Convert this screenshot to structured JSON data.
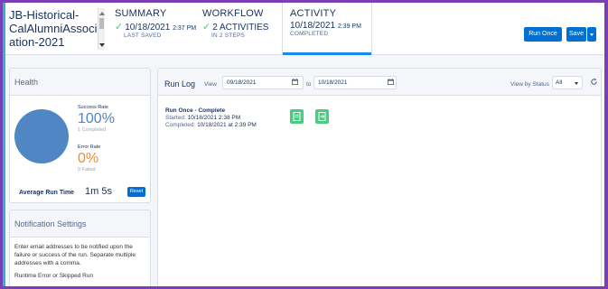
{
  "header": {
    "name": "JB-Historical-CalAlumniAssociation-2021",
    "steps": [
      {
        "title": "SUMMARY",
        "main": "10/18/2021",
        "main_small": "2:37 PM",
        "sub": "LAST SAVED"
      },
      {
        "title": "WORKFLOW",
        "main": "2 ACTIVITIES",
        "main_small": "",
        "sub": "IN 2 STEPS"
      },
      {
        "title": "ACTIVITY",
        "main": "10/18/2021",
        "main_small": "2:39 PM",
        "sub": "COMPLETED"
      }
    ],
    "run_once_label": "Run Once",
    "save_label": "Save"
  },
  "health": {
    "title": "Health",
    "success_label": "Success Rate",
    "success_value": "100%",
    "success_sub": "1 Completed",
    "error_label": "Error Rate",
    "error_value": "0%",
    "error_sub": "0 Failed",
    "avg_label": "Average Run Time",
    "avg_value": "1m 5s",
    "reset_label": "Reset",
    "success_color": "#4f86c3",
    "error_color": "#f28b30"
  },
  "notification": {
    "title": "Notification Settings",
    "body": "Enter email addresses to be notified upon the failure or success of the run. Separate multiple addresses with a comma.",
    "sub": "Runtime Error or Skipped Run"
  },
  "runlog": {
    "title": "Run Log",
    "view_label": "View",
    "from_date": "09/18/2021",
    "to_label": "to",
    "to_date": "10/18/2021",
    "status_label": "View by Status",
    "status_value": "All",
    "entry": {
      "title": "Run Once - Complete",
      "started_label": "Started:",
      "started_value": "10/18/2021 2:38 PM",
      "completed_label": "Completed:",
      "completed_value": "10/18/2021 at 2:39 PM"
    }
  }
}
